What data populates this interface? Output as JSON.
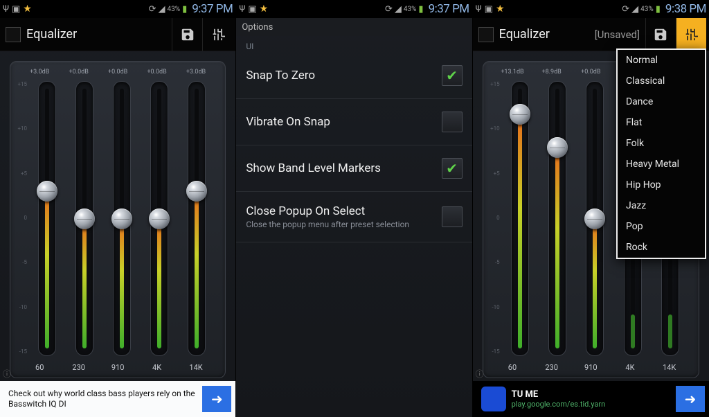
{
  "screen1": {
    "status": {
      "battery_pct": "43%",
      "time": "9:37 PM"
    },
    "header": {
      "title": "Equalizer"
    },
    "eq": {
      "db_labels": [
        "+3.0dB",
        "+0.0dB",
        "+0.0dB",
        "+0.0dB",
        "+3.0dB"
      ],
      "knob_pct": [
        40,
        50,
        50,
        50,
        40
      ],
      "freqs": [
        "60",
        "230",
        "910",
        "4K",
        "14K"
      ],
      "scale": [
        "+15",
        "+10",
        "+5",
        "0",
        "-5",
        "-10",
        "-15"
      ]
    },
    "ad": {
      "text": "Check out why world class bass players rely on the Basswitch IQ DI"
    }
  },
  "screen2": {
    "status": {
      "battery_pct": "43%",
      "time": "9:37 PM"
    },
    "header_title": "Options",
    "section": "UI",
    "items": [
      {
        "label": "Snap To Zero",
        "sub": "",
        "checked": true
      },
      {
        "label": "Vibrate On Snap",
        "sub": "",
        "checked": false
      },
      {
        "label": "Show Band Level Markers",
        "sub": "",
        "checked": true
      },
      {
        "label": "Close Popup On Select",
        "sub": "Close the popup menu after preset selection",
        "checked": false
      }
    ]
  },
  "screen3": {
    "status": {
      "battery_pct": "43%",
      "time": "9:38 PM"
    },
    "header": {
      "title": "Equalizer",
      "subtitle": "[Unsaved]"
    },
    "eq": {
      "db_labels": [
        "+13.1dB",
        "+8.9dB",
        "+0.0dB",
        "",
        ""
      ],
      "knob_pct": [
        12,
        24,
        50,
        null,
        null
      ],
      "freqs": [
        "60",
        "230",
        "910",
        "4K",
        "14K"
      ],
      "scale": [
        "+15",
        "+10",
        "+5",
        "0",
        "-5",
        "-10",
        "-15"
      ]
    },
    "presets": [
      "Normal",
      "Classical",
      "Dance",
      "Flat",
      "Folk",
      "Heavy Metal",
      "Hip Hop",
      "Jazz",
      "Pop",
      "Rock"
    ],
    "ad": {
      "title": "TU ME",
      "sub": "play.google.com/es.tid.yarn"
    }
  }
}
